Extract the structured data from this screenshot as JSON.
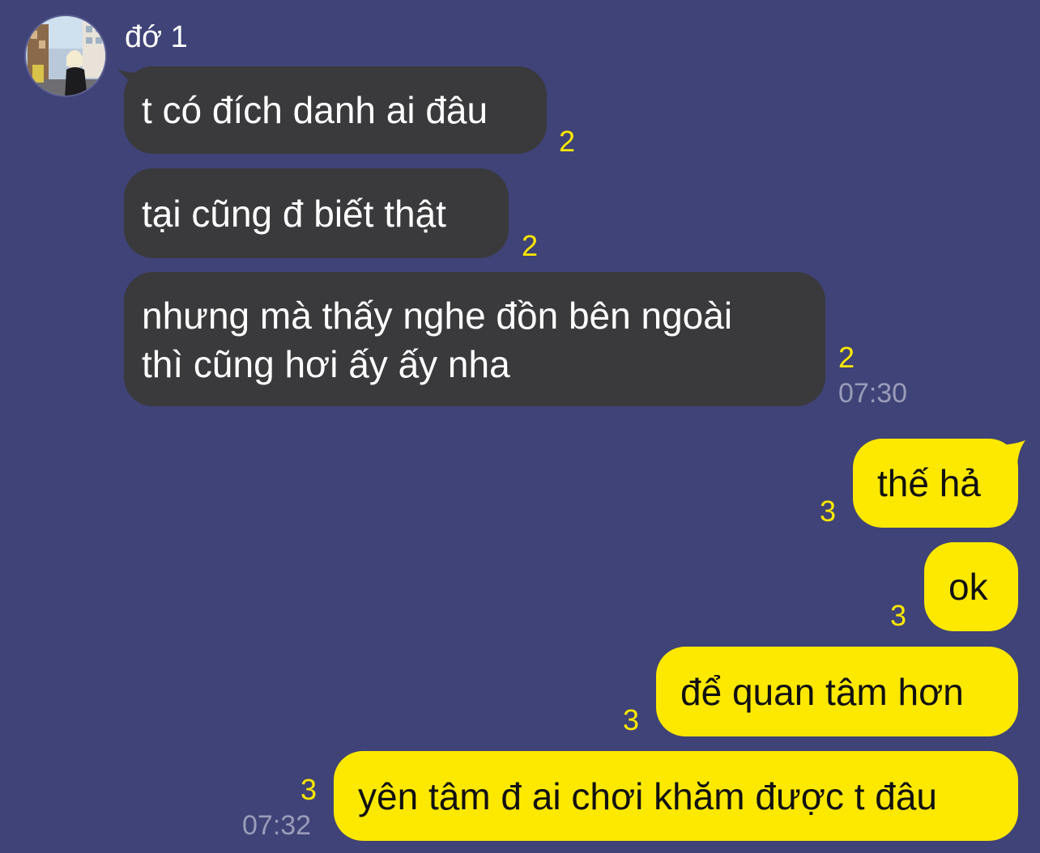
{
  "chat": {
    "sender": {
      "name": "đớ 1",
      "avatar_icon": "profile-photo"
    },
    "incoming": [
      {
        "text": "t có đích danh ai đâu",
        "read_count": "2"
      },
      {
        "text": "tại cũng đ biết thật",
        "read_count": "2"
      },
      {
        "text_line1": "nhưng mà thấy nghe đồn bên ngoài",
        "text_line2": "thì cũng hơi ấy ấy nha",
        "read_count": "2",
        "time": "07:30"
      }
    ],
    "outgoing": [
      {
        "text": "thế hả",
        "read_count": "3"
      },
      {
        "text": "ok",
        "read_count": "3"
      },
      {
        "text": "để quan tâm hơn",
        "read_count": "3"
      },
      {
        "text": "yên tâm đ ai chơi khăm được t đâu",
        "read_count": "3",
        "time": "07:32"
      }
    ],
    "colors": {
      "background": "#3f4377",
      "incoming_bubble": "#3a3a3c",
      "outgoing_bubble": "#fde800",
      "read_count": "#fde800",
      "timestamp": "#9a9cb8"
    }
  }
}
